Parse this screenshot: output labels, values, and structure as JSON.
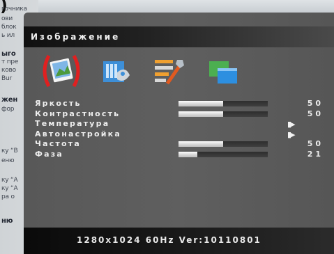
{
  "background_document": {
    "corner_mark": ")",
    "lines": [
      "гочника",
      "ови",
      "блок",
      "ь ил",
      "ыго",
      "т пре",
      "ково",
      "Bur",
      "жен",
      "фор",
      "ку “В",
      "еню",
      "ку “А",
      "ку “А",
      "ра о",
      "ню"
    ]
  },
  "osd": {
    "title": "Изображение",
    "tabs": [
      {
        "icon": "image-icon",
        "selected": true
      },
      {
        "icon": "color-palette-icon",
        "selected": false
      },
      {
        "icon": "tools-icon",
        "selected": false
      },
      {
        "icon": "windows-icon",
        "selected": false
      }
    ],
    "items": [
      {
        "label": "Яркость",
        "kind": "slider",
        "value": "50",
        "fraction": 0.5
      },
      {
        "label": "Контрастность",
        "kind": "slider",
        "value": "50",
        "fraction": 0.5
      },
      {
        "label": "Температура",
        "kind": "submenu",
        "arrow": "▮▶"
      },
      {
        "label": "Автонастройка",
        "kind": "submenu",
        "arrow": "▮▶"
      },
      {
        "label": "Частота",
        "kind": "slider",
        "value": "50",
        "fraction": 0.5
      },
      {
        "label": "Фаза",
        "kind": "slider",
        "value": "21",
        "fraction": 0.21
      }
    ],
    "footer": "1280x1024 60Hz Ver:10110801",
    "colors": {
      "highlight": "#e02020",
      "panel": "#5c5c5c",
      "bar": "#0a0a0a"
    }
  }
}
